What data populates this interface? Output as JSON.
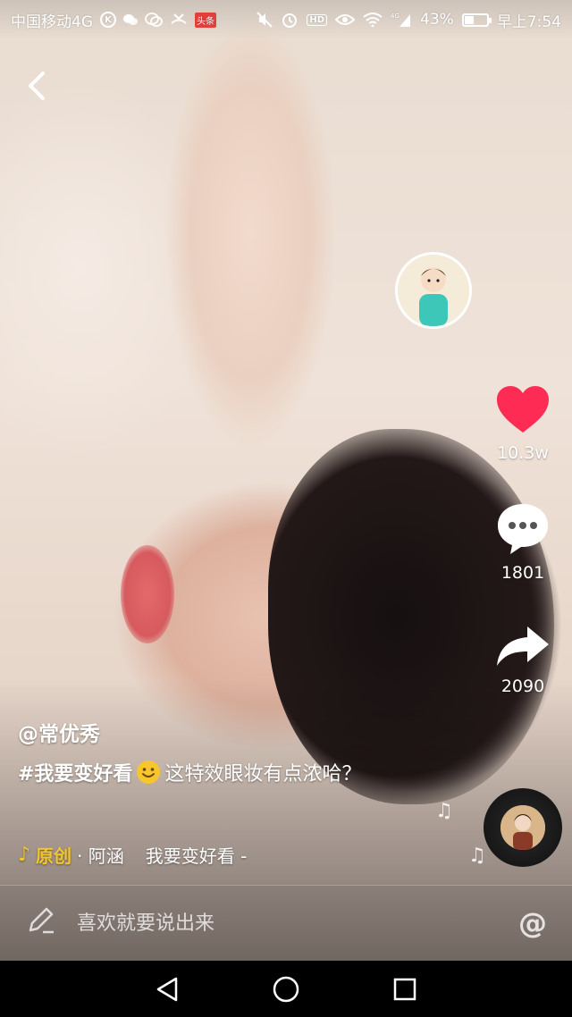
{
  "status_bar": {
    "carrier": "中国移动4G",
    "k_badge": "K",
    "hd_badge": "HD",
    "toutiao_badge": "头条",
    "network": "4G",
    "battery": "43%",
    "battery_level": 0.43,
    "time": "早上7:54"
  },
  "video": {
    "author": "@常优秀",
    "hashtag": "#我要变好看",
    "caption_text": "这特效眼妆有点浓哈？",
    "music_tag": "原创",
    "music_artist": "· 阿涵",
    "music_song": "我要变好看 -"
  },
  "rail": {
    "likes": "10.3w",
    "comments": "1801",
    "shares": "2090"
  },
  "comment_bar": {
    "placeholder": "喜欢就要说出来",
    "at_symbol": "@"
  },
  "colors": {
    "like": "#fe2c55",
    "music_accent": "#f3c62b"
  },
  "icons": [
    "back-arrow-icon",
    "heart-icon",
    "comment-bubble-icon",
    "share-arrow-icon",
    "music-note-icon",
    "pencil-icon",
    "at-icon",
    "nav-back-icon",
    "nav-home-icon",
    "nav-recents-icon"
  ]
}
